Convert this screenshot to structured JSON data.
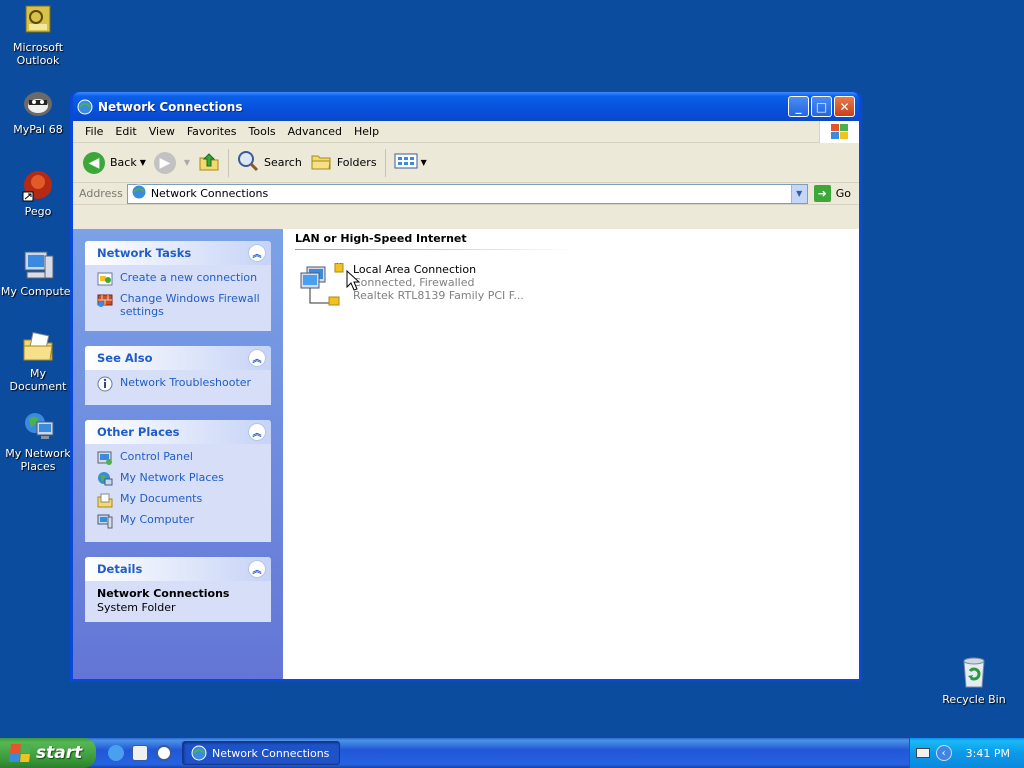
{
  "desktop": {
    "icons": [
      {
        "label": "Microsoft\nOutlook",
        "icon": "outlook-icon"
      },
      {
        "label": "MyPal 68",
        "icon": "mypal-icon"
      },
      {
        "label": "Pego",
        "icon": "pego-icon"
      },
      {
        "label": "My Computer",
        "icon": "my-computer-icon"
      },
      {
        "label": "My Document",
        "icon": "my-documents-icon"
      },
      {
        "label": "My Network\nPlaces",
        "icon": "my-network-places-icon"
      },
      {
        "label": "Recycle Bin",
        "icon": "recycle-bin-icon"
      }
    ]
  },
  "window": {
    "title": "Network Connections",
    "menu": [
      "File",
      "Edit",
      "View",
      "Favorites",
      "Tools",
      "Advanced",
      "Help"
    ],
    "toolbar": {
      "back": "Back",
      "search": "Search",
      "folders": "Folders"
    },
    "address": {
      "label": "Address",
      "value": "Network Connections",
      "go": "Go"
    }
  },
  "taskpane": {
    "network_tasks": {
      "title": "Network Tasks",
      "items": [
        "Create a new connection",
        "Change Windows Firewall settings"
      ]
    },
    "see_also": {
      "title": "See Also",
      "items": [
        "Network Troubleshooter"
      ]
    },
    "other_places": {
      "title": "Other Places",
      "items": [
        "Control Panel",
        "My Network Places",
        "My Documents",
        "My Computer"
      ]
    },
    "details": {
      "title": "Details",
      "name": "Network Connections",
      "type": "System Folder"
    }
  },
  "main": {
    "group_header": "LAN or High-Speed Internet",
    "connection": {
      "name": "Local Area Connection",
      "status": "Connected, Firewalled",
      "device": "Realtek RTL8139 Family PCI F..."
    }
  },
  "taskbar": {
    "start": "start",
    "active_task": "Network Connections",
    "clock": "3:41 PM"
  },
  "colors": {
    "desktop": "#0b4c9e",
    "link": "#215dc6",
    "taskbar": "#2157d7",
    "start_green": "#3a9a3a"
  }
}
